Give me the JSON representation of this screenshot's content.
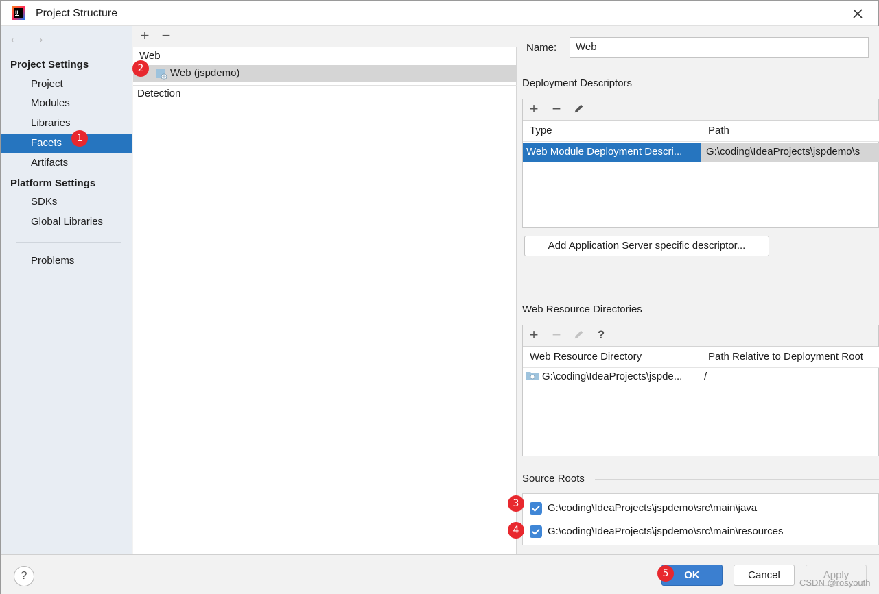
{
  "window": {
    "title": "Project Structure"
  },
  "nav": {
    "back_icon": "arrow-left-icon",
    "forward_icon": "arrow-right-icon",
    "project_settings_heading": "Project Settings",
    "project_settings_items": [
      "Project",
      "Modules",
      "Libraries",
      "Facets",
      "Artifacts"
    ],
    "selected_item": "Facets",
    "platform_settings_heading": "Platform Settings",
    "platform_settings_items": [
      "SDKs",
      "Global Libraries"
    ],
    "problems_label": "Problems"
  },
  "tree": {
    "add_icon": "+",
    "remove_icon": "−",
    "group_web": "Web",
    "selected_facet": "Web (jspdemo)",
    "group_detection": "Detection"
  },
  "detail": {
    "name_label": "Name:",
    "name_value": "Web",
    "deployment_descriptors": {
      "title": "Deployment Descriptors",
      "columns": [
        "Type",
        "Path"
      ],
      "rows": [
        {
          "type": "Web Module Deployment Descri...",
          "path": "G:\\coding\\IdeaProjects\\jspdemo\\s"
        }
      ],
      "add_server_button": "Add Application Server specific descriptor..."
    },
    "web_resource_directories": {
      "title": "Web Resource Directories",
      "help_icon": "?",
      "columns": [
        "Web Resource Directory",
        "Path Relative to Deployment Root"
      ],
      "rows": [
        {
          "directory": "G:\\coding\\IdeaProjects\\jspde...",
          "relative": "/"
        }
      ]
    },
    "source_roots": {
      "title": "Source Roots",
      "items": [
        {
          "label": "G:\\coding\\IdeaProjects\\jspdemo\\src\\main\\java",
          "checked": true
        },
        {
          "label": "G:\\coding\\IdeaProjects\\jspdemo\\src\\main\\resources",
          "checked": true
        }
      ]
    }
  },
  "footer": {
    "help_label": "?",
    "ok_label": "OK",
    "cancel_label": "Cancel",
    "apply_label": "Apply",
    "watermark": "CSDN @rosyouth"
  },
  "markers": [
    "1",
    "2",
    "3",
    "4",
    "5"
  ],
  "colors": {
    "selection_blue": "#2675bf",
    "marker_red": "#e8282e",
    "ok_button": "#3b7fd0"
  }
}
